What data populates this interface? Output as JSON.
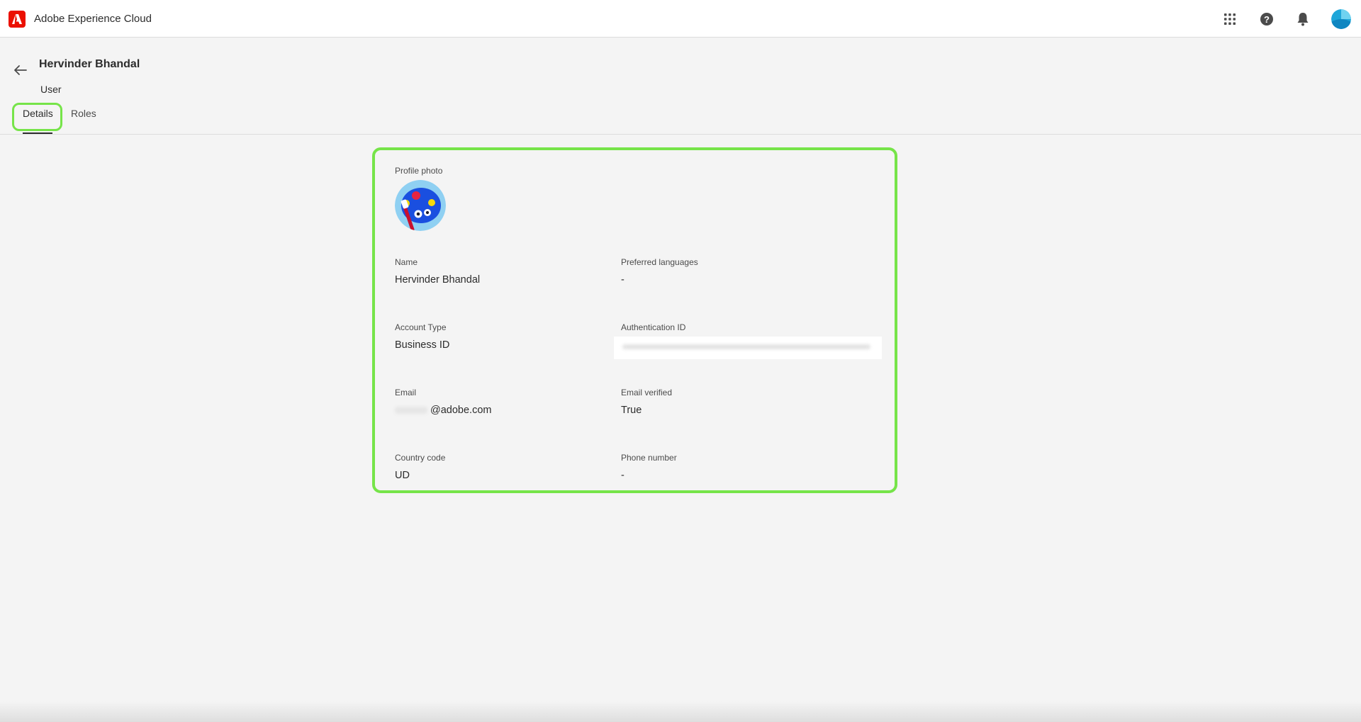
{
  "app": {
    "title": "Adobe Experience Cloud",
    "brand_color": "#eb1000"
  },
  "topbar": {
    "icons": [
      "apps-grid-icon",
      "help-icon",
      "bell-icon",
      "user-avatar"
    ]
  },
  "header": {
    "title": "Hervinder Bhandal",
    "subtitle": "User"
  },
  "tabs": [
    {
      "label": "Details",
      "selected": true
    },
    {
      "label": "Roles",
      "selected": false
    }
  ],
  "highlight_color": "#76e449",
  "profile": {
    "photo_label": "Profile photo",
    "fields": {
      "name": {
        "label": "Name",
        "value": "Hervinder Bhandal"
      },
      "preferred_languages": {
        "label": "Preferred languages",
        "value": "-"
      },
      "account_type": {
        "label": "Account Type",
        "value": "Business ID"
      },
      "authentication_id": {
        "label": "Authentication ID",
        "value": ""
      },
      "email": {
        "label": "Email",
        "value": "@adobe.com"
      },
      "email_verified": {
        "label": "Email verified",
        "value": "True"
      },
      "country_code": {
        "label": "Country code",
        "value": "UD"
      },
      "phone_number": {
        "label": "Phone number",
        "value": "-"
      }
    }
  }
}
